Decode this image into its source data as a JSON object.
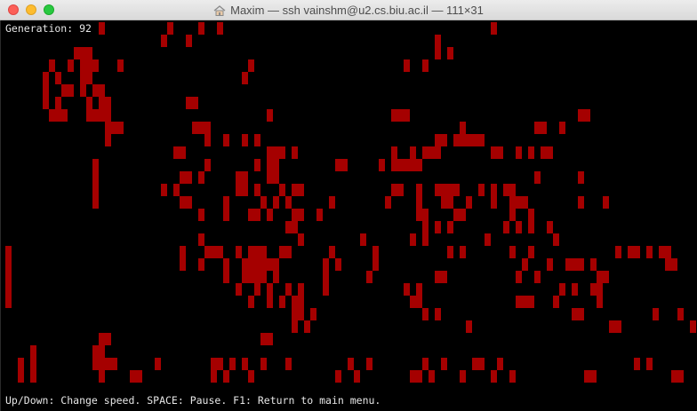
{
  "window": {
    "title": "Maxim — ssh vainshm@u2.cs.biu.ac.il — 111×31",
    "title_icon": "home-icon"
  },
  "terminal": {
    "generation_label": "Generation: 92",
    "status_line": "Up/Down: Change speed. SPACE: Pause. F1: Return to main menu.",
    "cell_color": "#a50000",
    "background_color": "#000000",
    "text_color": "#e6e6e6",
    "board_rows": [
      "...............X..........X....X..X...........................................X...............................",
      ".........................X...X.......................................X...............................................................",
      "...........XXX.......................................................X.X.......................................",
      ".......X..X.XXX...X....................X........................X..X............................................",
      "......X.X...XX........................X..................................................................................",
      "......X..XX.X.XX.....................................................................................................",
      "......X.X....X.XX............XX........................................................................................",
      ".......XXX...XXXX.........................X...................XXX...........................XX...................",
      "................XXX...........XXX........................................X...........XX..X....................",
      "................X...............X..X..X.X............................XX.XXXXX...................................",
      "...........................XX.............XXX.X...............X..X.XXX........XX..X.X.XX.......................",
      "..............X.................X.......X.XX.........XX.....X.XXXXX............................................",
      "..............X.............XX.X.....XX...XX.........................................X......X...................",
      "..............X..........X.X.........XX.X...X.XX..............XX..X..XXXX...X.X.XX...............................",
      "..............X.............XX.....X.....X.X.X......X........X....X...XX..X...X..XXX........X...X........................",
      "...............................X...X...XX.X...XX..X...............XX....XX.......X..X............................",
      ".............................................XX....................X.X.X........X.X.X..X..........................",
      "...............................X...............X.........X.......X.X.........X..........X....................",
      "X...........................X...XXX..X.XXX..XX......X......X...........X.X.......X..X.............X.XX.X.XX......",
      "X...........................X..X...X..XXXXXX.......X.X.....X.......................X...X..XXX.X...........XX....",
      "X..................................X..XXXX.X.......X......X..........XX...........X..X.........XX........",
      "X....................................X..X.X..X.X...X............X.X......................X.X..XX......",
      "X......................................X..X.X.XX.................XX...............XXX...X......X.......",
      "..............................................XX.X.................X.X.....................XX...........X...X.",
      "..............................................X.X.........................X......................XX...........X",
      "...............XX........................XX.............................................................................",
      "....X.........XX................................................................................................",
      "..X.X.........XXXX......X........XX.X.X..X...X.........X..X........X..X....XX..X.....................X.X........X",
      "..X.X..........X....XX...........X.X...X.............X..X........XX.X....X....X..X...........XX............XX",
      "..X.X........XXX..........X......X.X..................X..X........X..........XXX.XX.........X...XX..............",
      "..X.X...........................X.X................................XX..XX..XXXXX.............X.............X.X."
    ]
  }
}
